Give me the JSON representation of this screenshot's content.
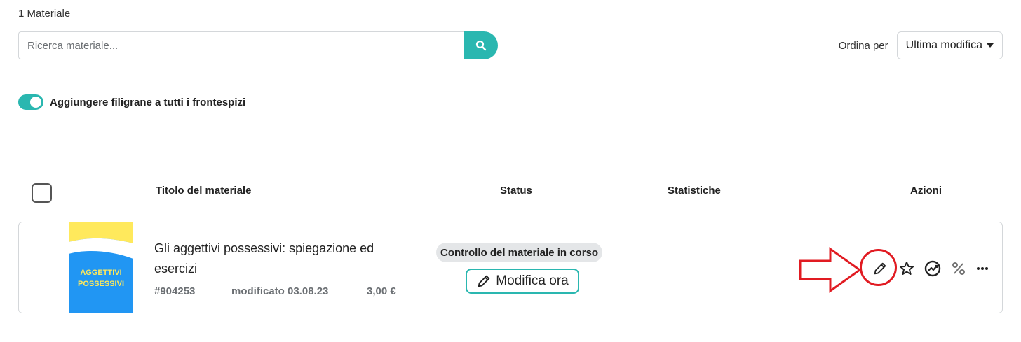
{
  "header": {
    "count": "1 Materiale"
  },
  "search": {
    "placeholder": "Ricerca materiale..."
  },
  "sort": {
    "label": "Ordina per",
    "selected": "Ultima modifica"
  },
  "watermark": {
    "label": "Aggiungere filigrane a tutti i frontespizi",
    "enabled": true
  },
  "table": {
    "columns": [
      "Titolo del materiale",
      "Status",
      "Statistiche",
      "Azioni"
    ]
  },
  "material": {
    "title": "Gli aggettivi possessivi: spiegazione ed esercizi",
    "thumbnail_text_1": "AGGETTIVI",
    "thumbnail_text_2": "POSSESSIVI",
    "id": "#904253",
    "modified": "modificato 03.08.23",
    "price": "3,00 €",
    "status": "Controllo del materiale in corso",
    "edit_now": "Modifica ora"
  },
  "colors": {
    "accent": "#2ab7b0",
    "annotation": "#e11b22",
    "thumb_blue": "#2196f3",
    "thumb_yellow": "#ffe95c"
  },
  "icons": [
    "search-icon",
    "pencil-icon",
    "star-icon",
    "stats-icon",
    "percent-icon",
    "more-icon"
  ]
}
